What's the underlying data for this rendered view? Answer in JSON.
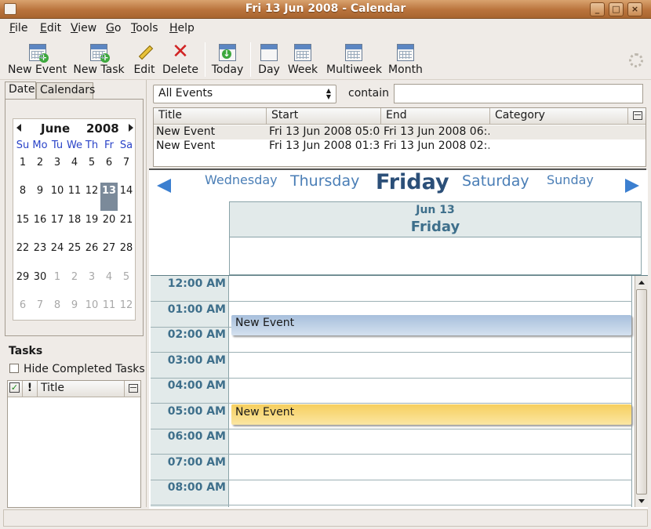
{
  "window": {
    "title": "Fri 13 Jun 2008 - Calendar",
    "min": "_",
    "max": "□",
    "close": "×"
  },
  "menu": [
    {
      "label": "File",
      "key": "F",
      "rest": "ile"
    },
    {
      "label": "Edit",
      "key": "E",
      "rest": "dit"
    },
    {
      "label": "View",
      "key": "V",
      "rest": "iew"
    },
    {
      "label": "Go",
      "key": "G",
      "rest": "o"
    },
    {
      "label": "Tools",
      "key": "T",
      "rest": "ools"
    },
    {
      "label": "Help",
      "key": "H",
      "rest": "elp"
    }
  ],
  "toolbar": {
    "new_event": "New Event",
    "new_task": "New Task",
    "edit": "Edit",
    "delete": "Delete",
    "today": "Today",
    "day": "Day",
    "week": "Week",
    "multiweek": "Multiweek",
    "month": "Month"
  },
  "left": {
    "tabs": [
      "Date",
      "Calendars"
    ],
    "minical": {
      "month": "June",
      "year": "2008",
      "dow": [
        "Su",
        "Mo",
        "Tu",
        "We",
        "Th",
        "Fr",
        "Sa"
      ],
      "weeks": [
        [
          "1",
          "2",
          "3",
          "4",
          "5",
          "6",
          "7"
        ],
        [
          "8",
          "9",
          "10",
          "11",
          "12",
          "13",
          "14"
        ],
        [
          "15",
          "16",
          "17",
          "18",
          "19",
          "20",
          "21"
        ],
        [
          "22",
          "23",
          "24",
          "25",
          "26",
          "27",
          "28"
        ],
        [
          "29",
          "30",
          "1",
          "2",
          "3",
          "4",
          "5"
        ],
        [
          "6",
          "7",
          "8",
          "9",
          "10",
          "11",
          "12"
        ]
      ],
      "selected": "13"
    },
    "tasks": {
      "title": "Tasks",
      "hide_completed": "Hide Completed Tasks",
      "col_title": "Title",
      "col_priority": "!"
    }
  },
  "search": {
    "filter": "All Events",
    "contain_label": "contain",
    "query": ""
  },
  "event_list": {
    "columns": [
      "Title",
      "Start",
      "End",
      "Category"
    ],
    "rows": [
      {
        "title": "New Event",
        "start": "Fri 13 Jun 2008 05:0...",
        "end": "Fri 13 Jun 2008 06:...",
        "category": ""
      },
      {
        "title": "New Event",
        "start": "Fri 13 Jun 2008 01:3...",
        "end": "Fri 13 Jun 2008 02:...",
        "category": ""
      }
    ]
  },
  "day_view": {
    "days": [
      "Wednesday",
      "Thursday",
      "Friday",
      "Saturday",
      "Sunday"
    ],
    "current_date": "Jun 13",
    "current_day": "Friday",
    "hours": [
      "12:00 AM",
      "01:00 AM",
      "02:00 AM",
      "03:00 AM",
      "04:00 AM",
      "05:00 AM",
      "06:00 AM",
      "07:00 AM",
      "08:00 AM"
    ],
    "events": [
      {
        "title": "New Event",
        "color": "#a7bfdc"
      },
      {
        "title": "New Event",
        "color": "#f6cf5e"
      }
    ]
  }
}
